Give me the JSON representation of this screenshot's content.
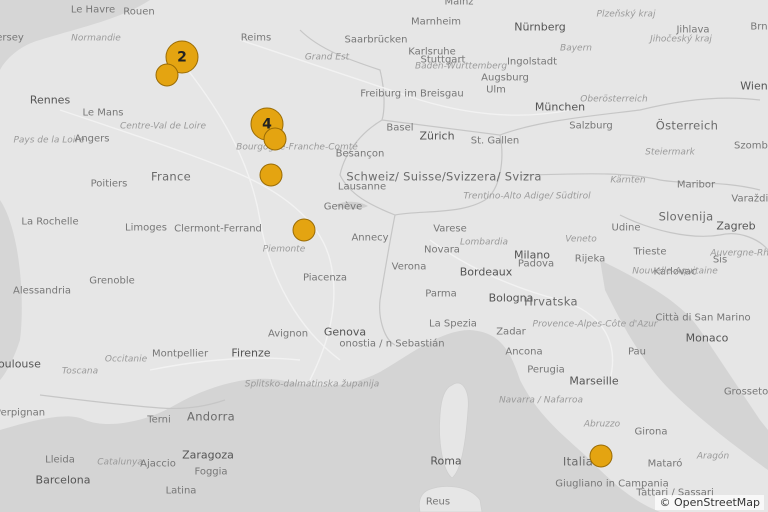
{
  "map": {
    "attribution": "© OpenStreetMap",
    "colors": {
      "land": "#e6e6e6",
      "water": "#d4d4d4",
      "marker_fill": "#e4a411",
      "marker_border": "#9a6c06",
      "border": "#c8c8c8"
    },
    "labels": [
      {
        "text": "Le Havre",
        "cls": "city"
      },
      {
        "text": "Rouen",
        "cls": "city"
      },
      {
        "text": "ersey",
        "cls": "city"
      },
      {
        "text": "Normandie",
        "cls": "region"
      },
      {
        "text": "Reims",
        "cls": "city"
      },
      {
        "text": "Mainz",
        "cls": "city"
      },
      {
        "text": "Marnheim",
        "cls": "city"
      },
      {
        "text": "Saarbrücken",
        "cls": "city"
      },
      {
        "text": "Karlsruhe",
        "cls": "city"
      },
      {
        "text": "Nürnberg",
        "cls": "bigcity"
      },
      {
        "text": "Bayern",
        "cls": "region"
      },
      {
        "text": "Plzeňský kraj",
        "cls": "region"
      },
      {
        "text": "Jihlava",
        "cls": "city"
      },
      {
        "text": "Jihočeský kraj",
        "cls": "region"
      },
      {
        "text": "Brn",
        "cls": "city"
      },
      {
        "text": "Grand Est",
        "cls": "region"
      },
      {
        "text": "Baden-Württemberg",
        "cls": "region"
      },
      {
        "text": "Ingolstadt",
        "cls": "city"
      },
      {
        "text": "Augsburg",
        "cls": "city"
      },
      {
        "text": "Stuttgart",
        "cls": "city"
      },
      {
        "text": "Rennes",
        "cls": "bigcity"
      },
      {
        "text": "Le Mans",
        "cls": "city"
      },
      {
        "text": "Freiburg im Breisgau",
        "cls": "city"
      },
      {
        "text": "Ulm",
        "cls": "city"
      },
      {
        "text": "München",
        "cls": "bigcity"
      },
      {
        "text": "Oberösterreich",
        "cls": "region"
      },
      {
        "text": "Wien",
        "cls": "bigcity"
      },
      {
        "text": "Centre-Val de Loire",
        "cls": "region"
      },
      {
        "text": "Basel",
        "cls": "city"
      },
      {
        "text": "Zürich",
        "cls": "bigcity"
      },
      {
        "text": "St. Gallen",
        "cls": "city"
      },
      {
        "text": "Salzburg",
        "cls": "city"
      },
      {
        "text": "Österreich",
        "cls": "country"
      },
      {
        "text": "Pays de la Loire",
        "cls": "region"
      },
      {
        "text": "Angers",
        "cls": "city"
      },
      {
        "text": "Bourgogne-Franche-Comté",
        "cls": "region"
      },
      {
        "text": "Besançon",
        "cls": "city"
      },
      {
        "text": "Szomba",
        "cls": "city"
      },
      {
        "text": "Steiermark",
        "cls": "region"
      },
      {
        "text": "Schweiz/ Suisse/Svizzera/ Svizra",
        "cls": "country"
      },
      {
        "text": "France",
        "cls": "country"
      },
      {
        "text": "Poitiers",
        "cls": "city"
      },
      {
        "text": "Lausanne",
        "cls": "city"
      },
      {
        "text": "Kärnten",
        "cls": "region"
      },
      {
        "text": "Maribor",
        "cls": "city"
      },
      {
        "text": "Trentino-Alto Adige/ Südtirol",
        "cls": "region"
      },
      {
        "text": "Varaždin",
        "cls": "city"
      },
      {
        "text": "Genève",
        "cls": "city"
      },
      {
        "text": "Slovenija",
        "cls": "country"
      },
      {
        "text": "La Rochelle",
        "cls": "city"
      },
      {
        "text": "Clermont-Ferrand",
        "cls": "city"
      },
      {
        "text": "Limoges",
        "cls": "city"
      },
      {
        "text": "Annecy",
        "cls": "city"
      },
      {
        "text": "Varese",
        "cls": "city"
      },
      {
        "text": "Udine",
        "cls": "city"
      },
      {
        "text": "Zagreb",
        "cls": "bigcity"
      },
      {
        "text": "Lombardia",
        "cls": "region"
      },
      {
        "text": "Veneto",
        "cls": "region"
      },
      {
        "text": "Novara",
        "cls": "city"
      },
      {
        "text": "Milano",
        "cls": "bigcity"
      },
      {
        "text": "Trieste",
        "cls": "city"
      },
      {
        "text": "Karlovac",
        "cls": "city"
      },
      {
        "text": "Sis",
        "cls": "city"
      },
      {
        "text": "Auvergne-Rhône-Alpes",
        "cls": "region"
      },
      {
        "text": "Piemonte",
        "cls": "region"
      },
      {
        "text": "Verona",
        "cls": "city"
      },
      {
        "text": "Padova",
        "cls": "city"
      },
      {
        "text": "Rijeka",
        "cls": "city"
      },
      {
        "text": "Nouvelle-Aquitaine",
        "cls": "region"
      },
      {
        "text": "Grenoble",
        "cls": "city"
      },
      {
        "text": "Piacenza",
        "cls": "city"
      },
      {
        "text": "Bordeaux",
        "cls": "bigcity"
      },
      {
        "text": "Alessandria",
        "cls": "city"
      },
      {
        "text": "Parma",
        "cls": "city"
      },
      {
        "text": "Bologna",
        "cls": "bigcity"
      },
      {
        "text": "Hrvatska",
        "cls": "country"
      },
      {
        "text": "Città di San Marino",
        "cls": "city"
      },
      {
        "text": "Provence-Alpes-Côte d'Azur",
        "cls": "region"
      },
      {
        "text": "Avignon",
        "cls": "city"
      },
      {
        "text": "Genova",
        "cls": "bigcity"
      },
      {
        "text": "La Spezia",
        "cls": "city"
      },
      {
        "text": "Zadar",
        "cls": "city"
      },
      {
        "text": "Monaco",
        "cls": "bigcity"
      },
      {
        "text": "onostia / n Sebastián",
        "cls": "city"
      },
      {
        "text": "Toulouse",
        "cls": "bigcity"
      },
      {
        "text": "Occitanie",
        "cls": "region"
      },
      {
        "text": "Montpellier",
        "cls": "city"
      },
      {
        "text": "Firenze",
        "cls": "bigcity"
      },
      {
        "text": "Ancona",
        "cls": "city"
      },
      {
        "text": "Pau",
        "cls": "city"
      },
      {
        "text": "Toscana",
        "cls": "region"
      },
      {
        "text": "Perugia",
        "cls": "city"
      },
      {
        "text": "Marseille",
        "cls": "bigcity"
      },
      {
        "text": "Splitsko-dalmatinska županija",
        "cls": "region"
      },
      {
        "text": "Grosseto",
        "cls": "city"
      },
      {
        "text": "Navarra / Nafarroa",
        "cls": "region"
      },
      {
        "text": "Perpignan",
        "cls": "city"
      },
      {
        "text": "Andorra",
        "cls": "country"
      },
      {
        "text": "Terni",
        "cls": "city"
      },
      {
        "text": "Abruzzo",
        "cls": "region"
      },
      {
        "text": "Girona",
        "cls": "city"
      },
      {
        "text": "Zaragoza",
        "cls": "bigcity"
      },
      {
        "text": "Lleida",
        "cls": "city"
      },
      {
        "text": "Catalunya",
        "cls": "region"
      },
      {
        "text": "Ajaccio",
        "cls": "city"
      },
      {
        "text": "Roma",
        "cls": "bigcity"
      },
      {
        "text": "Italia",
        "cls": "country"
      },
      {
        "text": "Mataró",
        "cls": "city"
      },
      {
        "text": "Foggia",
        "cls": "city"
      },
      {
        "text": "Aragón",
        "cls": "region"
      },
      {
        "text": "Barcelona",
        "cls": "bigcity"
      },
      {
        "text": "Latina",
        "cls": "city"
      },
      {
        "text": "Giugliano in Campania",
        "cls": "city"
      },
      {
        "text": "Tàttari / Sassari",
        "cls": "city"
      },
      {
        "text": "Reus",
        "cls": "city"
      }
    ],
    "markers": [
      {
        "count": "2",
        "kind": "cluster"
      },
      {
        "count": "",
        "kind": "single"
      },
      {
        "count": "4",
        "kind": "cluster"
      },
      {
        "count": "",
        "kind": "single"
      },
      {
        "count": "",
        "kind": "single"
      },
      {
        "count": "",
        "kind": "single"
      },
      {
        "count": "",
        "kind": "single"
      }
    ]
  }
}
